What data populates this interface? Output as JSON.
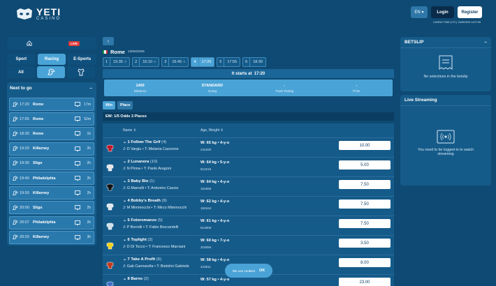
{
  "header": {
    "logo_main": "YETI",
    "logo_sub": "CASINO",
    "language": "EN",
    "login_label": "Login",
    "register_label": "Register",
    "casino_time": "CASINO TIME (UTC) 13/05/2025 14:07:59"
  },
  "nav": {
    "live_label": "LIVE",
    "sport_tabs": [
      "Sport",
      "Racing",
      "E-Sports"
    ],
    "active_sport": "Racing",
    "filter_all": "All"
  },
  "next_to_go": {
    "title": "Next to go",
    "rows": [
      {
        "time": "17:20",
        "name": "Rome",
        "mins": "17m"
      },
      {
        "time": "17:55",
        "name": "Rome",
        "mins": "52m"
      },
      {
        "time": "18:30",
        "name": "Rome",
        "mins": "1h"
      },
      {
        "time": "19:20",
        "name": "Killarney",
        "mins": "2h"
      },
      {
        "time": "19:30",
        "name": "Sligo",
        "mins": "2h"
      },
      {
        "time": "19:40",
        "name": "Philadelphia",
        "mins": "2h"
      },
      {
        "time": "19:50",
        "name": "Killarney",
        "mins": "2h"
      },
      {
        "time": "20:00",
        "name": "Sligo",
        "mins": "2h"
      },
      {
        "time": "20:07",
        "name": "Philadelphia",
        "mins": "2h"
      },
      {
        "time": "20:20",
        "name": "Killarney",
        "mins": "3h"
      }
    ]
  },
  "race": {
    "venue": "Rome",
    "date": "13/05/2025",
    "tabs": [
      {
        "num": "1",
        "time": "15:35"
      },
      {
        "num": "2",
        "time": "16:10"
      },
      {
        "num": "3",
        "time": "16:45"
      },
      {
        "num": "4",
        "time": "17:20"
      },
      {
        "num": "5",
        "time": "17:55"
      },
      {
        "num": "6",
        "time": "18:30"
      }
    ],
    "starts_text": "It starts at",
    "starts_time": "17:20",
    "info": [
      {
        "value": "1400",
        "label": "Distance"
      },
      {
        "value": "STANDARD",
        "label": "Going"
      },
      {
        "value": "-",
        "label": "Track Rating"
      },
      {
        "value": "-",
        "label": "Prize"
      }
    ],
    "bet_modes": [
      "Win",
      "Place"
    ],
    "ew_text": "EW: 1/5 Odds 3 Places",
    "col_name": "Name",
    "col_age": "Age, Weight",
    "runners": [
      {
        "title": "1 Follow The Grif",
        "num": "(4)",
        "jt": "J: D Vargiu • T: Melania Cascione",
        "wt": "W: 65 kg • 4-y-o",
        "form": "242320",
        "odds": "10.00",
        "silk": "#c0182a"
      },
      {
        "title": "2 Lunanera",
        "num": "(10)",
        "jt": "J: N Pinna • T: Paolo Aragoni",
        "wt": "W: 64 kg • 5-y-o",
        "form": "512215",
        "odds": "5.00",
        "silk": "#e6e6e6"
      },
      {
        "title": "3 Baby Bio",
        "num": "(1)",
        "jt": "J: G Marcelli • T: Antonino Cascio",
        "wt": "W: 64 kg • 4-y-o",
        "form": "151955",
        "odds": "7.50",
        "silk": "#111111"
      },
      {
        "title": "4 Bobby's Breath",
        "num": "(9)",
        "jt": "J: M Mimmocchi • T: Mirco Mimmocchi",
        "wt": "W: 62 kg • 4-y-o",
        "form": "150444",
        "odds": "7.50",
        "silk": "#dfe8ee"
      },
      {
        "title": "5 Fotoromanzo",
        "num": "(5)",
        "jt": "J: P Borrelli • T: Fabio Boccardelli",
        "wt": "W: 61 kg • 4-y-o",
        "form": "512800",
        "odds": "7.50",
        "silk": "#cfe0ea"
      },
      {
        "title": "6 Toplight",
        "num": "(3)",
        "jt": "J: D Di Tocco • T: Francesco Marciani",
        "wt": "W: 60 kg • 7-y-o",
        "form": "316094",
        "odds": "3.50",
        "silk": "#f2d21b"
      },
      {
        "title": "7 Take A Profit",
        "num": "(6)",
        "jt": "J: Gab Cannarella • T: Bietolini Gabriele",
        "wt": "W: 58 kg • 4-y-o",
        "form": "423611",
        "odds": "8.00",
        "silk": "#c23a1e"
      },
      {
        "title": "8 Barno",
        "num": "(2)",
        "jt": "",
        "wt": "W: 57 kg • 4-y-o",
        "form": "",
        "odds": "23.00",
        "silk": "#3b6ec9"
      }
    ]
  },
  "betslip": {
    "title": "BETSLIP",
    "empty_text": "No selections in the betslip"
  },
  "live_streaming": {
    "title": "Live Streaming",
    "text": "You need to be logged-in to watch streaming"
  },
  "cookie": {
    "text": "We use cookies",
    "ok": "OK"
  }
}
